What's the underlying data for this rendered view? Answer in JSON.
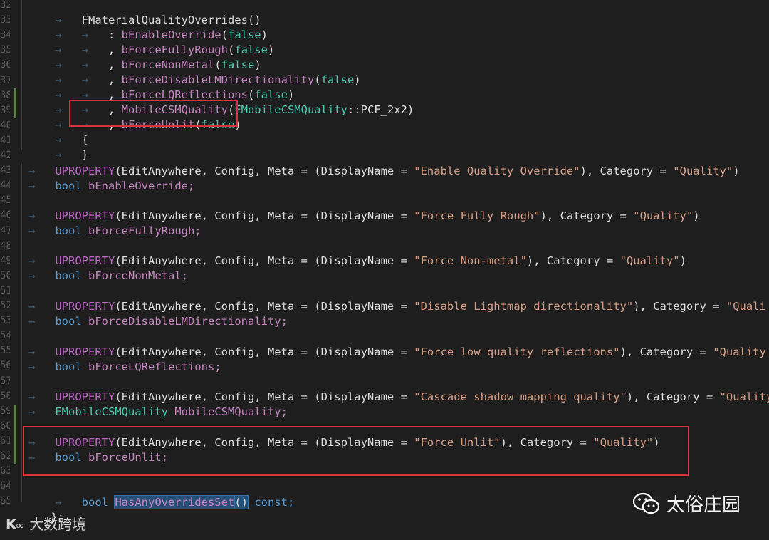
{
  "editor": {
    "line_numbers": [
      "32",
      "33",
      "34",
      "35",
      "36",
      "37",
      "38",
      "39",
      "40",
      "41",
      "42",
      "43",
      "44",
      "45",
      "46",
      "47",
      "48",
      "49",
      "50",
      "51",
      "52",
      "53",
      "54",
      "55",
      "56",
      "57",
      "58",
      "59",
      "60",
      "61",
      "62",
      "63",
      "64",
      "65"
    ],
    "lines": {
      "l1": {
        "name": "FMaterialQualityOverrides",
        "paren": "()"
      },
      "l2": {
        "sep": ": ",
        "member": "bEnableOverride",
        "open": "(",
        "val": "false",
        "close": ")"
      },
      "l3": {
        "sep": ", ",
        "member": "bForceFullyRough",
        "open": "(",
        "val": "false",
        "close": ")"
      },
      "l4": {
        "sep": ", ",
        "member": "bForceNonMetal",
        "open": "(",
        "val": "false",
        "close": ")"
      },
      "l5": {
        "sep": ", ",
        "member": "bForceDisableLMDirectionality",
        "open": "(",
        "val": "false",
        "close": ")"
      },
      "l6": {
        "sep": ", ",
        "member": "bForceLQReflections",
        "open": "(",
        "val": "false",
        "close": ")"
      },
      "l7": {
        "sep": ", ",
        "member": "MobileCSMQuality",
        "open": "(",
        "type": "EMobileCSMQuality",
        "scope": "::",
        "enum": "PCF_2x2",
        "close": ")"
      },
      "l8": {
        "sep": ", ",
        "member": "bForceUnlit",
        "open": "(",
        "val": "false",
        "close": ")"
      },
      "l9": {
        "text": "{"
      },
      "l10": {
        "text": "}"
      }
    },
    "props": [
      {
        "macro": "UPROPERTY",
        "args": "(EditAnywhere, Config, Meta = (DisplayName = ",
        "display": "\"Enable Quality Override\"",
        "mid": "), Category = ",
        "cat": "\"Quality\"",
        "end": ")",
        "type": "bool",
        "var": "bEnableOverride;"
      },
      {
        "macro": "UPROPERTY",
        "args": "(EditAnywhere, Config, Meta = (DisplayName = ",
        "display": "\"Force Fully Rough\"",
        "mid": "), Category = ",
        "cat": "\"Quality\"",
        "end": ")",
        "type": "bool",
        "var": "bForceFullyRough;"
      },
      {
        "macro": "UPROPERTY",
        "args": "(EditAnywhere, Config, Meta = (DisplayName = ",
        "display": "\"Force Non-metal\"",
        "mid": "), Category = ",
        "cat": "\"Quality\"",
        "end": ")",
        "type": "bool",
        "var": "bForceNonMetal;"
      },
      {
        "macro": "UPROPERTY",
        "args": "(EditAnywhere, Config, Meta = (DisplayName = ",
        "display": "\"Disable Lightmap directionality\"",
        "mid": "), Category = ",
        "cat": "\"Quali",
        "end": "",
        "type": "bool",
        "var": "bForceDisableLMDirectionality;"
      },
      {
        "macro": "UPROPERTY",
        "args": "(EditAnywhere, Config, Meta = (DisplayName = ",
        "display": "\"Force low quality reflections\"",
        "mid": "), Category = ",
        "cat": "\"Quality",
        "end": "",
        "type": "bool",
        "var": "bForceLQReflections;"
      },
      {
        "macro": "UPROPERTY",
        "args": "(EditAnywhere, Config, Meta = (DisplayName = ",
        "display": "\"Cascade shadow mapping quality\"",
        "mid": "), Category = ",
        "cat": "\"Quality",
        "end": "",
        "type": "EMobileCSMQuality",
        "var": "MobileCSMQuality;"
      },
      {
        "macro": "UPROPERTY",
        "args": "(EditAnywhere, Config, Meta = (DisplayName = ",
        "display": "\"Force Unlit\"",
        "mid": "), Category = ",
        "cat": "\"Quality\"",
        "end": ")",
        "type": "bool",
        "var": "bForceUnlit;"
      }
    ],
    "last": {
      "type": "bool",
      "func": "HasAnyOverridesSet",
      "paren": "()",
      "suffix": " const;"
    },
    "closing": "};"
  },
  "watermarks": {
    "left": "大数跨境",
    "right": "太俗庄园"
  },
  "colors": {
    "highlight_box": "#d6343a",
    "background": "#1e1e1e"
  }
}
